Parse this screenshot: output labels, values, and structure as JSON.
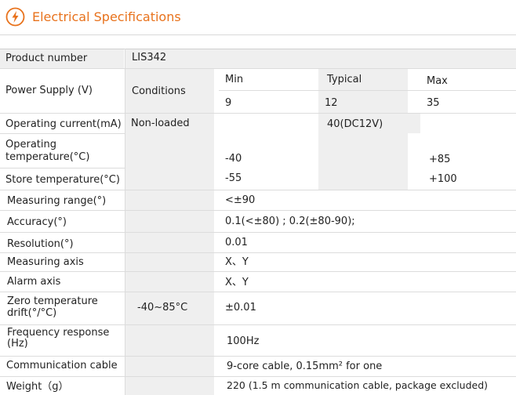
{
  "header": {
    "title": "Electrical Specifications",
    "icon": "lightning-bolt-icon",
    "accent_color": "#e8721c"
  },
  "table": {
    "product_number": {
      "label": "Product number",
      "value": "LIS342"
    },
    "power_supply": {
      "label": "Power  Supply (V)",
      "conditions": "Conditions",
      "min_label": "Min",
      "typical_label": "Typical",
      "max_label": "Max",
      "min": "9",
      "typical": "12",
      "max": "35"
    },
    "operating_current": {
      "label": "Operating current(mA)",
      "condition": "Non-loaded",
      "typical": "40(DC12V)"
    },
    "operating_temperature": {
      "label": "Operating temperature(°C)",
      "min": "-40",
      "max": "+85"
    },
    "store_temperature": {
      "label": "Store temperature(°C)",
      "min": "-55",
      "max": "+100"
    },
    "measuring_range": {
      "label": "Measuring range(°)",
      "value": "<±90"
    },
    "accuracy": {
      "label": "Accuracy(°)",
      "value": "0.1(<±80) ; 0.2(±80-90);"
    },
    "resolution": {
      "label": "Resolution(°)",
      "value": "0.01"
    },
    "measuring_axis": {
      "label": "Measuring axis",
      "value": "X、Y"
    },
    "alarm_axis": {
      "label": "Alarm axis",
      "value": "X、Y"
    },
    "zero_temperature_drift": {
      "label": "Zero temperature drift(°/°C)",
      "condition": "-40~85°C",
      "value": "±0.01"
    },
    "frequency_response": {
      "label": "Frequency response (Hz)",
      "value": "100Hz"
    },
    "communication_cable": {
      "label": "Communication cable",
      "value": "9-core cable, 0.15mm² for one"
    },
    "weight": {
      "label": "Weight（g）",
      "value": "220  (1.5 m communication cable, package excluded)"
    }
  }
}
